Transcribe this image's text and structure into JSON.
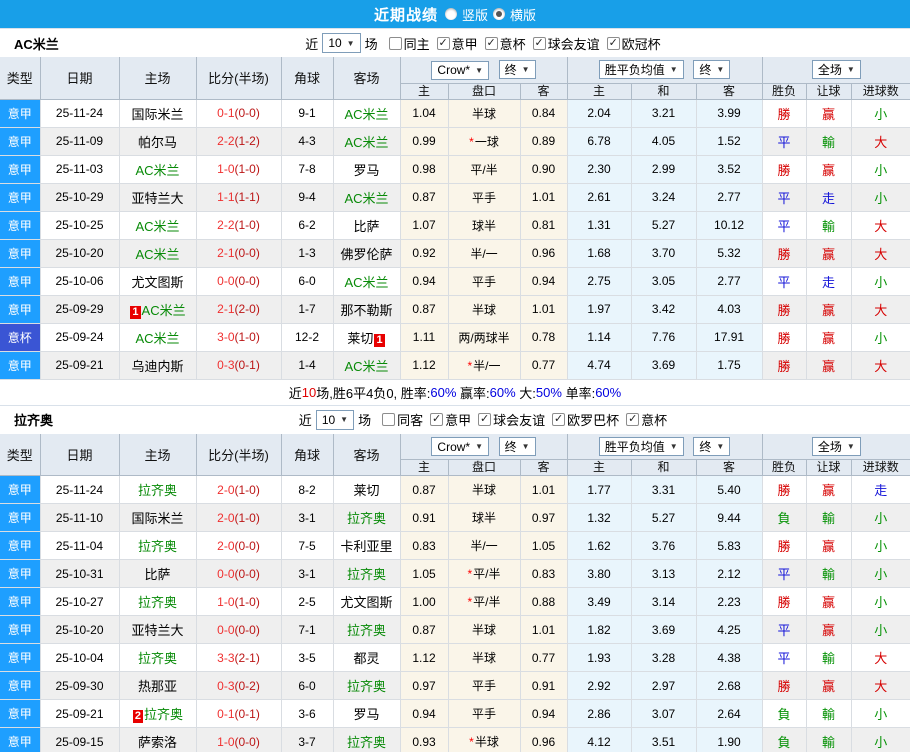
{
  "page": {
    "title": "近期战绩",
    "layout_options": [
      {
        "label": "竖版",
        "selected": false
      },
      {
        "label": "横版",
        "selected": true
      }
    ],
    "colors": {
      "topbar": "#189fe8",
      "type_serie_a": "#1e9fff",
      "type_coppa": "#3a55d4",
      "focus_team": "#078a07",
      "win": "#d60000",
      "draw": "#1414d8",
      "lose": "#079307"
    }
  },
  "table_header": {
    "cols": [
      "类型",
      "日期",
      "主场",
      "比分(半场)",
      "角球",
      "客场"
    ],
    "odds_group": {
      "dropdown": "Crow*",
      "final_dropdown": "终",
      "sub": [
        "主",
        "盘口",
        "客"
      ]
    },
    "mean_group": {
      "dropdown": "胜平负均值",
      "final_dropdown": "终",
      "sub": [
        "主",
        "和",
        "客"
      ]
    },
    "result_group": {
      "dropdown": "全场",
      "sub": [
        "胜负",
        "让球",
        "进球数"
      ]
    }
  },
  "sections": [
    {
      "team": "AC米兰",
      "recent_prefix": "近",
      "recent_count": "10",
      "recent_suffix": "场",
      "filters": [
        {
          "label": "同主",
          "checked": false
        },
        {
          "label": "意甲",
          "checked": true
        },
        {
          "label": "意杯",
          "checked": true
        },
        {
          "label": "球会友谊",
          "checked": true
        },
        {
          "label": "欧冠杯",
          "checked": true
        }
      ],
      "rows": [
        {
          "type": "意甲",
          "type_color": "blue",
          "date": "25-11-24",
          "home": "国际米兰",
          "home_focus": false,
          "score": "0-1",
          "half": "(0-0)",
          "corner": "9-1",
          "away": "AC米兰",
          "away_focus": true,
          "odds_home": "1.04",
          "handicap": "半球",
          "handicap_star": false,
          "odds_away": "0.84",
          "mean_home": "2.04",
          "mean_draw": "3.21",
          "mean_away": "3.99",
          "result": "勝",
          "result_color": "red",
          "handicap_result": "赢",
          "handicap_result_color": "red",
          "goals": "小",
          "goals_color": "green"
        },
        {
          "type": "意甲",
          "type_color": "blue",
          "date": "25-11-09",
          "home": "帕尔马",
          "home_focus": false,
          "score": "2-2",
          "half": "(1-2)",
          "corner": "4-3",
          "away": "AC米兰",
          "away_focus": true,
          "odds_home": "0.99",
          "handicap": "一球",
          "handicap_star": true,
          "odds_away": "0.89",
          "mean_home": "6.78",
          "mean_draw": "4.05",
          "mean_away": "1.52",
          "result": "平",
          "result_color": "blue",
          "handicap_result": "輸",
          "handicap_result_color": "green",
          "goals": "大",
          "goals_color": "red"
        },
        {
          "type": "意甲",
          "type_color": "blue",
          "date": "25-11-03",
          "home": "AC米兰",
          "home_focus": true,
          "score": "1-0",
          "half": "(1-0)",
          "corner": "7-8",
          "away": "罗马",
          "away_focus": false,
          "odds_home": "0.98",
          "handicap": "平/半",
          "handicap_star": false,
          "odds_away": "0.90",
          "mean_home": "2.30",
          "mean_draw": "2.99",
          "mean_away": "3.52",
          "result": "勝",
          "result_color": "red",
          "handicap_result": "赢",
          "handicap_result_color": "red",
          "goals": "小",
          "goals_color": "green"
        },
        {
          "type": "意甲",
          "type_color": "blue",
          "date": "25-10-29",
          "home": "亚特兰大",
          "home_focus": false,
          "score": "1-1",
          "half": "(1-1)",
          "corner": "9-4",
          "away": "AC米兰",
          "away_focus": true,
          "odds_home": "0.87",
          "handicap": "平手",
          "handicap_star": false,
          "odds_away": "1.01",
          "mean_home": "2.61",
          "mean_draw": "3.24",
          "mean_away": "2.77",
          "result": "平",
          "result_color": "blue",
          "handicap_result": "走",
          "handicap_result_color": "blue",
          "goals": "小",
          "goals_color": "green"
        },
        {
          "type": "意甲",
          "type_color": "blue",
          "date": "25-10-25",
          "home": "AC米兰",
          "home_focus": true,
          "score": "2-2",
          "half": "(1-0)",
          "corner": "6-2",
          "away": "比萨",
          "away_focus": false,
          "odds_home": "1.07",
          "handicap": "球半",
          "handicap_star": false,
          "odds_away": "0.81",
          "mean_home": "1.31",
          "mean_draw": "5.27",
          "mean_away": "10.12",
          "result": "平",
          "result_color": "blue",
          "handicap_result": "輸",
          "handicap_result_color": "green",
          "goals": "大",
          "goals_color": "red"
        },
        {
          "type": "意甲",
          "type_color": "blue",
          "date": "25-10-20",
          "home": "AC米兰",
          "home_focus": true,
          "score": "2-1",
          "half": "(0-0)",
          "corner": "1-3",
          "away": "佛罗伦萨",
          "away_focus": false,
          "odds_home": "0.92",
          "handicap": "半/一",
          "handicap_star": false,
          "odds_away": "0.96",
          "mean_home": "1.68",
          "mean_draw": "3.70",
          "mean_away": "5.32",
          "result": "勝",
          "result_color": "red",
          "handicap_result": "赢",
          "handicap_result_color": "red",
          "goals": "大",
          "goals_color": "red"
        },
        {
          "type": "意甲",
          "type_color": "blue",
          "date": "25-10-06",
          "home": "尤文图斯",
          "home_focus": false,
          "score": "0-0",
          "half": "(0-0)",
          "corner": "6-0",
          "away": "AC米兰",
          "away_focus": true,
          "odds_home": "0.94",
          "handicap": "平手",
          "handicap_star": false,
          "odds_away": "0.94",
          "mean_home": "2.75",
          "mean_draw": "3.05",
          "mean_away": "2.77",
          "result": "平",
          "result_color": "blue",
          "handicap_result": "走",
          "handicap_result_color": "blue",
          "goals": "小",
          "goals_color": "green"
        },
        {
          "type": "意甲",
          "type_color": "blue",
          "date": "25-09-29",
          "home": "AC米兰",
          "home_focus": true,
          "home_badge": "1",
          "home_badge_pos": "pre",
          "score": "2-1",
          "half": "(2-0)",
          "corner": "1-7",
          "away": "那不勒斯",
          "away_focus": false,
          "odds_home": "0.87",
          "handicap": "半球",
          "handicap_star": false,
          "odds_away": "1.01",
          "mean_home": "1.97",
          "mean_draw": "3.42",
          "mean_away": "4.03",
          "result": "勝",
          "result_color": "red",
          "handicap_result": "赢",
          "handicap_result_color": "red",
          "goals": "大",
          "goals_color": "red"
        },
        {
          "type": "意杯",
          "type_color": "royal",
          "date": "25-09-24",
          "home": "AC米兰",
          "home_focus": true,
          "score": "3-0",
          "half": "(1-0)",
          "corner": "12-2",
          "away": "莱切",
          "away_focus": false,
          "away_badge": "1",
          "away_badge_pos": "post",
          "odds_home": "1.11",
          "handicap": "两/两球半",
          "handicap_star": false,
          "odds_away": "0.78",
          "mean_home": "1.14",
          "mean_draw": "7.76",
          "mean_away": "17.91",
          "result": "勝",
          "result_color": "red",
          "handicap_result": "赢",
          "handicap_result_color": "red",
          "goals": "小",
          "goals_color": "green"
        },
        {
          "type": "意甲",
          "type_color": "blue",
          "date": "25-09-21",
          "home": "乌迪内斯",
          "home_focus": false,
          "score": "0-3",
          "half": "(0-1)",
          "corner": "1-4",
          "away": "AC米兰",
          "away_focus": true,
          "odds_home": "1.12",
          "handicap": "半/一",
          "handicap_star": true,
          "odds_away": "0.77",
          "mean_home": "4.74",
          "mean_draw": "3.69",
          "mean_away": "1.75",
          "result": "勝",
          "result_color": "red",
          "handicap_result": "赢",
          "handicap_result_color": "red",
          "goals": "大",
          "goals_color": "red"
        }
      ],
      "summary_parts": [
        {
          "t": "近",
          "c": "k"
        },
        {
          "t": "10",
          "c": "r"
        },
        {
          "t": "场,胜6平4负0, 胜率:",
          "c": "k"
        },
        {
          "t": "60%",
          "c": "b"
        },
        {
          "t": " 赢率:",
          "c": "k"
        },
        {
          "t": "60%",
          "c": "b"
        },
        {
          "t": " 大:",
          "c": "k"
        },
        {
          "t": "50%",
          "c": "b"
        },
        {
          "t": " 单率:",
          "c": "k"
        },
        {
          "t": "60%",
          "c": "b"
        }
      ]
    },
    {
      "team": "拉齐奥",
      "recent_prefix": "近",
      "recent_count": "10",
      "recent_suffix": "场",
      "filters": [
        {
          "label": "同客",
          "checked": false
        },
        {
          "label": "意甲",
          "checked": true
        },
        {
          "label": "球会友谊",
          "checked": true
        },
        {
          "label": "欧罗巴杯",
          "checked": true
        },
        {
          "label": "意杯",
          "checked": true
        }
      ],
      "rows": [
        {
          "type": "意甲",
          "type_color": "blue",
          "date": "25-11-24",
          "home": "拉齐奥",
          "home_focus": true,
          "score": "2-0",
          "half": "(1-0)",
          "corner": "8-2",
          "away": "莱切",
          "away_focus": false,
          "odds_home": "0.87",
          "handicap": "半球",
          "handicap_star": false,
          "odds_away": "1.01",
          "mean_home": "1.77",
          "mean_draw": "3.31",
          "mean_away": "5.40",
          "result": "勝",
          "result_color": "red",
          "handicap_result": "赢",
          "handicap_result_color": "red",
          "goals": "走",
          "goals_color": "blue"
        },
        {
          "type": "意甲",
          "type_color": "blue",
          "date": "25-11-10",
          "home": "国际米兰",
          "home_focus": false,
          "score": "2-0",
          "half": "(1-0)",
          "corner": "3-1",
          "away": "拉齐奥",
          "away_focus": true,
          "odds_home": "0.91",
          "handicap": "球半",
          "handicap_star": false,
          "odds_away": "0.97",
          "mean_home": "1.32",
          "mean_draw": "5.27",
          "mean_away": "9.44",
          "result": "負",
          "result_color": "green",
          "handicap_result": "輸",
          "handicap_result_color": "green",
          "goals": "小",
          "goals_color": "green"
        },
        {
          "type": "意甲",
          "type_color": "blue",
          "date": "25-11-04",
          "home": "拉齐奥",
          "home_focus": true,
          "score": "2-0",
          "half": "(0-0)",
          "corner": "7-5",
          "away": "卡利亚里",
          "away_focus": false,
          "odds_home": "0.83",
          "handicap": "半/一",
          "handicap_star": false,
          "odds_away": "1.05",
          "mean_home": "1.62",
          "mean_draw": "3.76",
          "mean_away": "5.83",
          "result": "勝",
          "result_color": "red",
          "handicap_result": "赢",
          "handicap_result_color": "red",
          "goals": "小",
          "goals_color": "green"
        },
        {
          "type": "意甲",
          "type_color": "blue",
          "date": "25-10-31",
          "home": "比萨",
          "home_focus": false,
          "score": "0-0",
          "half": "(0-0)",
          "corner": "3-1",
          "away": "拉齐奥",
          "away_focus": true,
          "odds_home": "1.05",
          "handicap": "平/半",
          "handicap_star": true,
          "odds_away": "0.83",
          "mean_home": "3.80",
          "mean_draw": "3.13",
          "mean_away": "2.12",
          "result": "平",
          "result_color": "blue",
          "handicap_result": "輸",
          "handicap_result_color": "green",
          "goals": "小",
          "goals_color": "green"
        },
        {
          "type": "意甲",
          "type_color": "blue",
          "date": "25-10-27",
          "home": "拉齐奥",
          "home_focus": true,
          "score": "1-0",
          "half": "(1-0)",
          "corner": "2-5",
          "away": "尤文图斯",
          "away_focus": false,
          "odds_home": "1.00",
          "handicap": "平/半",
          "handicap_star": true,
          "odds_away": "0.88",
          "mean_home": "3.49",
          "mean_draw": "3.14",
          "mean_away": "2.23",
          "result": "勝",
          "result_color": "red",
          "handicap_result": "赢",
          "handicap_result_color": "red",
          "goals": "小",
          "goals_color": "green"
        },
        {
          "type": "意甲",
          "type_color": "blue",
          "date": "25-10-20",
          "home": "亚特兰大",
          "home_focus": false,
          "score": "0-0",
          "half": "(0-0)",
          "corner": "7-1",
          "away": "拉齐奥",
          "away_focus": true,
          "odds_home": "0.87",
          "handicap": "半球",
          "handicap_star": false,
          "odds_away": "1.01",
          "mean_home": "1.82",
          "mean_draw": "3.69",
          "mean_away": "4.25",
          "result": "平",
          "result_color": "blue",
          "handicap_result": "赢",
          "handicap_result_color": "red",
          "goals": "小",
          "goals_color": "green"
        },
        {
          "type": "意甲",
          "type_color": "blue",
          "date": "25-10-04",
          "home": "拉齐奥",
          "home_focus": true,
          "score": "3-3",
          "half": "(2-1)",
          "corner": "3-5",
          "away": "都灵",
          "away_focus": false,
          "odds_home": "1.12",
          "handicap": "半球",
          "handicap_star": false,
          "odds_away": "0.77",
          "mean_home": "1.93",
          "mean_draw": "3.28",
          "mean_away": "4.38",
          "result": "平",
          "result_color": "blue",
          "handicap_result": "輸",
          "handicap_result_color": "green",
          "goals": "大",
          "goals_color": "red"
        },
        {
          "type": "意甲",
          "type_color": "blue",
          "date": "25-09-30",
          "home": "热那亚",
          "home_focus": false,
          "score": "0-3",
          "half": "(0-2)",
          "corner": "6-0",
          "away": "拉齐奥",
          "away_focus": true,
          "odds_home": "0.97",
          "handicap": "平手",
          "handicap_star": false,
          "odds_away": "0.91",
          "mean_home": "2.92",
          "mean_draw": "2.97",
          "mean_away": "2.68",
          "result": "勝",
          "result_color": "red",
          "handicap_result": "赢",
          "handicap_result_color": "red",
          "goals": "大",
          "goals_color": "red"
        },
        {
          "type": "意甲",
          "type_color": "blue",
          "date": "25-09-21",
          "home": "拉齐奥",
          "home_focus": true,
          "home_badge": "2",
          "home_badge_pos": "pre",
          "score": "0-1",
          "half": "(0-1)",
          "corner": "3-6",
          "away": "罗马",
          "away_focus": false,
          "odds_home": "0.94",
          "handicap": "平手",
          "handicap_star": false,
          "odds_away": "0.94",
          "mean_home": "2.86",
          "mean_draw": "3.07",
          "mean_away": "2.64",
          "result": "負",
          "result_color": "green",
          "handicap_result": "輸",
          "handicap_result_color": "green",
          "goals": "小",
          "goals_color": "green"
        },
        {
          "type": "意甲",
          "type_color": "blue",
          "date": "25-09-15",
          "home": "萨索洛",
          "home_focus": false,
          "score": "1-0",
          "half": "(0-0)",
          "corner": "3-7",
          "away": "拉齐奥",
          "away_focus": true,
          "odds_home": "0.93",
          "handicap": "半球",
          "handicap_star": true,
          "odds_away": "0.96",
          "mean_home": "4.12",
          "mean_draw": "3.51",
          "mean_away": "1.90",
          "result": "負",
          "result_color": "green",
          "handicap_result": "輸",
          "handicap_result_color": "green",
          "goals": "小",
          "goals_color": "green"
        }
      ]
    }
  ]
}
